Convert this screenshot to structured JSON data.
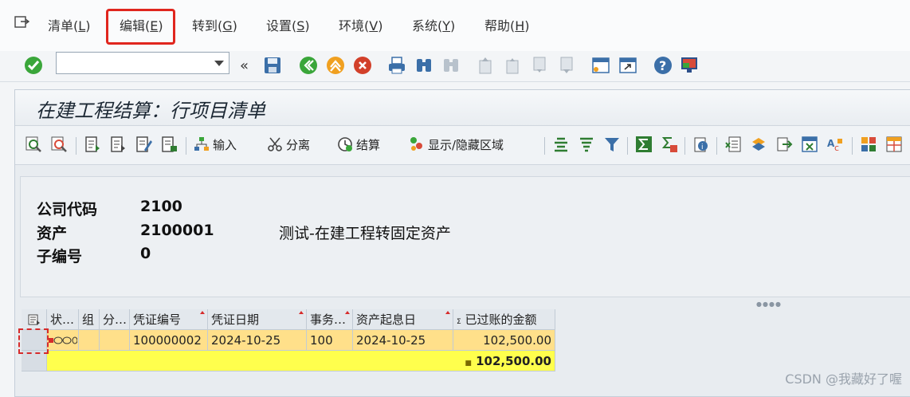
{
  "menu": {
    "items": [
      {
        "label": "清单",
        "key": "L"
      },
      {
        "label": "编辑",
        "key": "E"
      },
      {
        "label": "转到",
        "key": "G"
      },
      {
        "label": "设置",
        "key": "S"
      },
      {
        "label": "环境",
        "key": "V"
      },
      {
        "label": "系统",
        "key": "Y"
      },
      {
        "label": "帮助",
        "key": "H"
      }
    ]
  },
  "toolbar": {
    "command_value": ""
  },
  "window": {
    "title": "在建工程结算：行项目清单",
    "app_buttons": {
      "input": "输入",
      "split": "分离",
      "settle": "结算",
      "show_hide": "显示/隐藏区域"
    }
  },
  "header": {
    "company_code_label": "公司代码",
    "company_code": "2100",
    "asset_label": "资产",
    "asset": "2100001",
    "asset_desc": "测试-在建工程转固定资产",
    "subnumber_label": "子编号",
    "subnumber": "0"
  },
  "grid": {
    "columns": [
      "状…",
      "组",
      "分…",
      "凭证编号",
      "凭证日期",
      "事务…",
      "资产起息日",
      "已过账的金额"
    ],
    "rows": [
      {
        "doc_no": "100000002",
        "doc_date": "2024-10-25",
        "trans": "100",
        "cap_date": "2024-10-25",
        "amount": "102,500.00"
      }
    ],
    "total": "102,500.00",
    "total_marker": "■"
  },
  "watermark": "CSDN @我藏好了喔",
  "colors": {
    "highlight": "#e0261e",
    "row": "#ffe08a",
    "total_row": "#ffff4d"
  }
}
